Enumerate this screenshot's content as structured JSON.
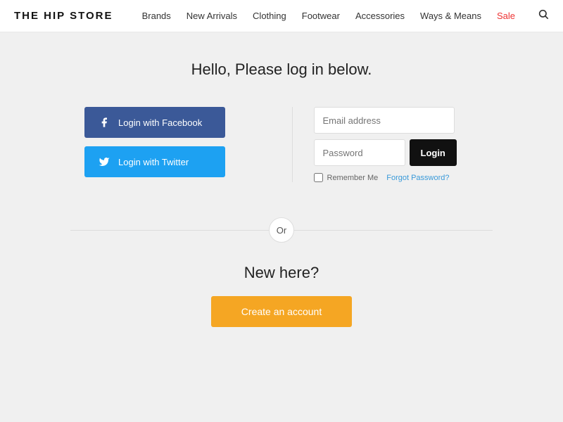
{
  "header": {
    "logo": "THE HIP STORE",
    "nav": {
      "items": [
        {
          "label": "Brands",
          "sale": false
        },
        {
          "label": "New Arrivals",
          "sale": false
        },
        {
          "label": "Clothing",
          "sale": false
        },
        {
          "label": "Footwear",
          "sale": false
        },
        {
          "label": "Accessories",
          "sale": false
        },
        {
          "label": "Ways & Means",
          "sale": false
        },
        {
          "label": "Sale",
          "sale": true
        }
      ]
    }
  },
  "main": {
    "title": "Hello, Please log in below.",
    "social": {
      "facebook_label": "Login with Facebook",
      "twitter_label": "Login with Twitter"
    },
    "form": {
      "email_placeholder": "Email address",
      "password_placeholder": "Password",
      "login_button": "Login",
      "remember_label": "Remember Me",
      "forgot_label": "Forgot Password?"
    },
    "or_label": "Or",
    "new_here": {
      "title": "New here?",
      "create_button": "Create an account"
    }
  }
}
